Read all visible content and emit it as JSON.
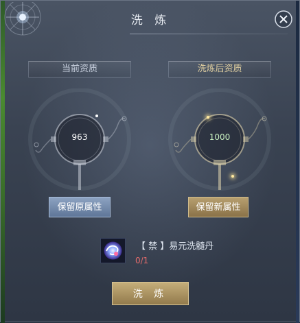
{
  "window": {
    "title": "洗 炼"
  },
  "sections": {
    "current": {
      "label": "当前资质",
      "value": "963"
    },
    "after": {
      "label": "洗炼后资质",
      "value": "1000"
    }
  },
  "buttons": {
    "keep_original": "保留原属性",
    "keep_new": "保留新属性",
    "refine": "洗 炼"
  },
  "item": {
    "name": "【 禁 】易元洗髓丹",
    "count": "0/1",
    "icon": "refine-pill-icon"
  },
  "colors": {
    "accent_gold": "#c5ae7a",
    "keep_original_blue": "#7a8fb0",
    "count_red": "#e36b6b",
    "after_value_green": "#c8f0c0"
  }
}
